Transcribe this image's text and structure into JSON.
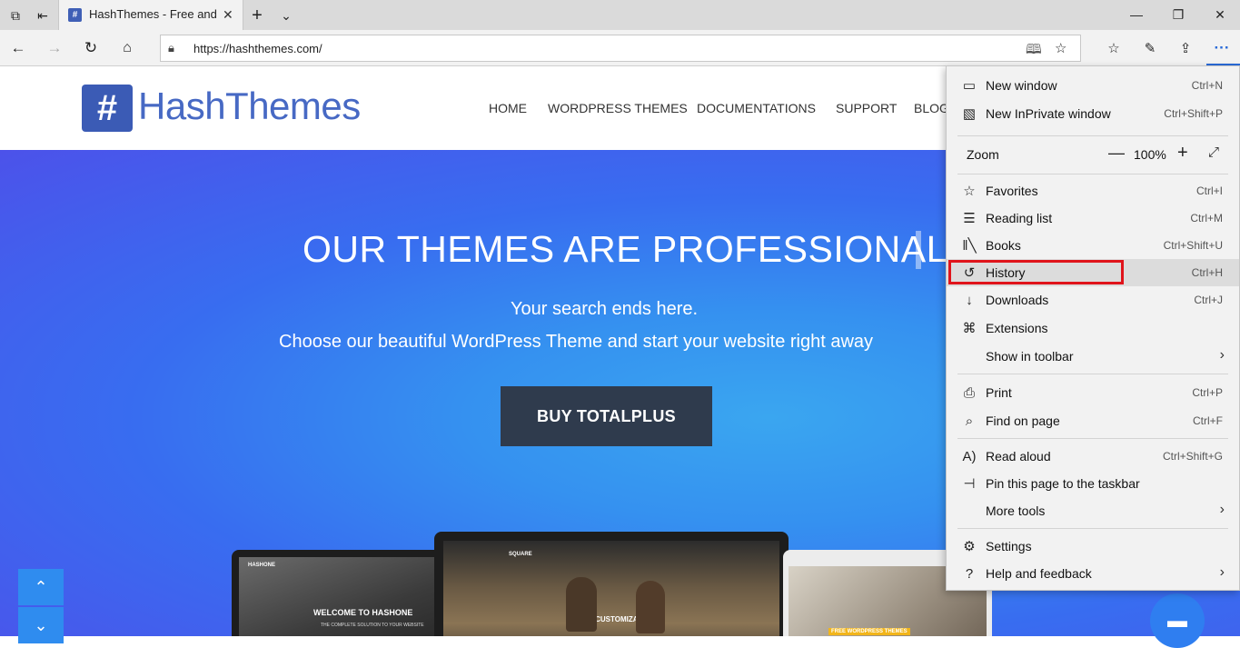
{
  "browser": {
    "tab_title": "HashThemes - Free and",
    "url": "https://hashthemes.com/",
    "menu_button_label": "···"
  },
  "site": {
    "logo_text": "HashThemes",
    "nav": [
      "HOME",
      "WORDPRESS THEMES",
      "DOCUMENTATIONS",
      "SUPPORT",
      "BLOG"
    ],
    "hero_title": "OUR THEMES ARE PROFESSIONAL",
    "hero_sub1": "Your search ends here.",
    "hero_sub2": "Choose our beautiful WordPress Theme and start your website right away",
    "buy_button": "BUY TOTALPLUS",
    "mock_left_brand": "HASHONE",
    "mock_left_headline": "WELCOME TO HASHONE",
    "mock_left_tagline": "THE COMPLETE SOLUTION TO YOUR WEBSITE",
    "mock_center_brand": "SQUARE",
    "mock_center_headline": "FULLY CUSTOMIZABLE",
    "mock_right_badge": "FREE WORDPRESS THEMES"
  },
  "menu": {
    "new_window": {
      "label": "New window",
      "shortcut": "Ctrl+N"
    },
    "new_inprivate": {
      "label": "New InPrivate window",
      "shortcut": "Ctrl+Shift+P"
    },
    "zoom": {
      "label": "Zoom",
      "value": "100%"
    },
    "favorites": {
      "label": "Favorites",
      "shortcut": "Ctrl+I"
    },
    "reading_list": {
      "label": "Reading list",
      "shortcut": "Ctrl+M"
    },
    "books": {
      "label": "Books",
      "shortcut": "Ctrl+Shift+U"
    },
    "history": {
      "label": "History",
      "shortcut": "Ctrl+H"
    },
    "downloads": {
      "label": "Downloads",
      "shortcut": "Ctrl+J"
    },
    "extensions": {
      "label": "Extensions"
    },
    "show_in_toolbar": {
      "label": "Show in toolbar"
    },
    "print": {
      "label": "Print",
      "shortcut": "Ctrl+P"
    },
    "find_on_page": {
      "label": "Find on page",
      "shortcut": "Ctrl+F"
    },
    "read_aloud": {
      "label": "Read aloud",
      "shortcut": "Ctrl+Shift+G"
    },
    "pin_taskbar": {
      "label": "Pin this page to the taskbar"
    },
    "more_tools": {
      "label": "More tools"
    },
    "settings": {
      "label": "Settings"
    },
    "help_feedback": {
      "label": "Help and feedback"
    }
  },
  "colors": {
    "highlight_box": "#e0141b",
    "brand_blue": "#3b5bb5",
    "buy_button_bg": "#2f3b4d"
  }
}
